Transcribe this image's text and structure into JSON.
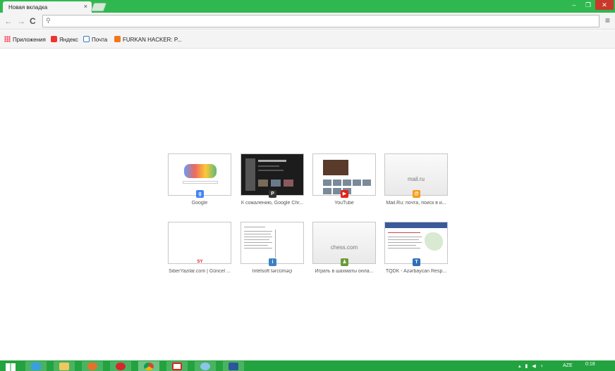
{
  "tab": {
    "title": "Новая вкладка",
    "close": "×"
  },
  "window": {
    "minimize": "–",
    "maximize": "❐",
    "close": "✕"
  },
  "toolbar": {
    "back": "←",
    "forward": "→",
    "reload": "C",
    "search_icon": "search-icon",
    "omnibox_value": "",
    "menu": "≡"
  },
  "bookmarks": [
    {
      "label": "Приложения",
      "icon": "apps-icon"
    },
    {
      "label": "Яндекс",
      "icon": "yandex-icon"
    },
    {
      "label": "Почта",
      "icon": "mail-icon"
    },
    {
      "label": "FURKAN HACKER: P...",
      "icon": "blogger-icon"
    }
  ],
  "tiles": [
    {
      "caption": "Google",
      "favicon": "g",
      "favicon_color": "#4285f4"
    },
    {
      "caption": "К сожалению, Google Chr...",
      "favicon": "P",
      "favicon_color": "#333333"
    },
    {
      "caption": "YouTube",
      "favicon": "▶",
      "favicon_color": "#e62117"
    },
    {
      "caption": "Mail.Ru: почта, поиск в и...",
      "thumb_text": "mail.ru",
      "favicon": "@",
      "favicon_color": "#f59b19"
    },
    {
      "caption": "SiberYazilar.com | Güncel ...",
      "favicon": "SY",
      "favicon_color": "#e02020"
    },
    {
      "caption": "İntelsoft tərcüməçi",
      "favicon": "i",
      "favicon_color": "#3b82c4"
    },
    {
      "caption": "Играть в шахматы онла...",
      "thumb_text": "chess.com",
      "favicon": "♟",
      "favicon_color": "#6a9b3a"
    },
    {
      "caption": "TQDK - Azərbaycan Resp...",
      "favicon": "T",
      "favicon_color": "#2f6fb8"
    }
  ],
  "taskbar": {
    "tray": "AZE",
    "clock": "0:18"
  }
}
